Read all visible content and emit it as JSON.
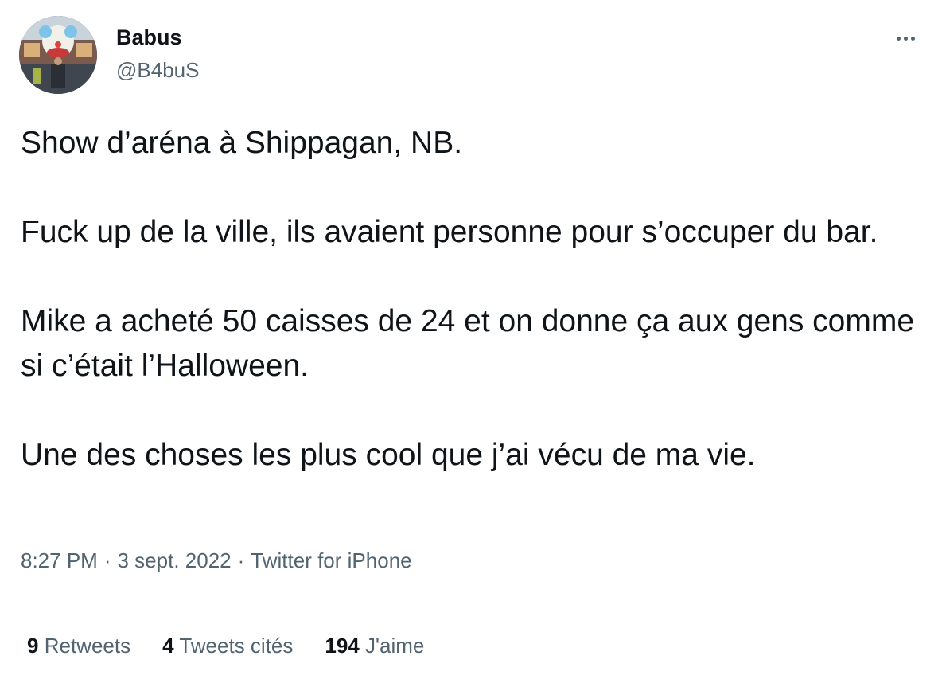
{
  "user": {
    "display_name": "Babus",
    "handle": "@B4buS",
    "avatar_icon": "profile-avatar"
  },
  "more_icon": "more-horizontal-icon",
  "tweet": {
    "paragraphs": [
      "Show d’aréna à Shippagan, NB.",
      "Fuck up de la ville, ils avaient personne pour s’occuper du bar.",
      "Mike a acheté 50 caisses de 24 et on donne ça aux gens comme si c’était l’Halloween.",
      "Une des choses les plus cool que j’ai vécu de ma vie."
    ]
  },
  "meta": {
    "time": "8:27 PM",
    "separator": "·",
    "date": "3 sept. 2022",
    "source": "Twitter for iPhone"
  },
  "stats": {
    "retweets_count": "9",
    "retweets_label": "Retweets",
    "quotes_count": "4",
    "quotes_label": "Tweets cités",
    "likes_count": "194",
    "likes_label": "J'aime"
  },
  "colors": {
    "text": "#0f1419",
    "secondary": "#536471",
    "divider": "#e6ecf0"
  }
}
